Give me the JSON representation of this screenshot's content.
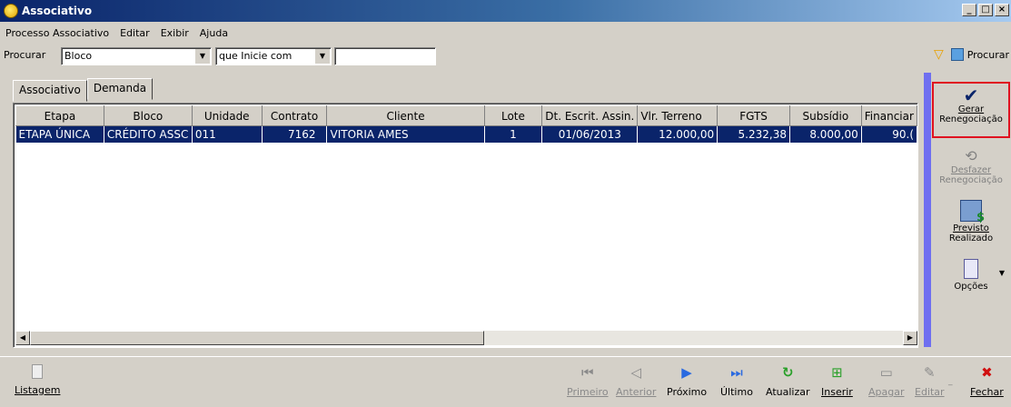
{
  "window": {
    "title": "Associativo"
  },
  "menu": [
    "Processo Associativo",
    "Editar",
    "Exibir",
    "Ajuda"
  ],
  "search": {
    "label": "Procurar",
    "field_value": "Bloco",
    "mode_value": "que Inicie com",
    "text_value": "",
    "button_label": "Procurar"
  },
  "tabs": [
    "Associativo",
    "Demanda"
  ],
  "grid": {
    "columns": [
      "Etapa",
      "Bloco",
      "Unidade",
      "Contrato",
      "Cliente",
      "Lote",
      "Dt. Escrit. Assin.",
      "Vlr. Terreno",
      "FGTS",
      "Subsídio",
      "Financiar"
    ],
    "rows": [
      [
        "ETAPA ÚNICA",
        "CRÉDITO ASSC",
        "011",
        "7162",
        "VITORIA AMES",
        "1",
        "01/06/2013",
        "12.000,00",
        "5.232,38",
        "8.000,00",
        "90.("
      ]
    ]
  },
  "sidebar": {
    "gerar_line1": "Gerar",
    "gerar_line2": "Renegociação",
    "desfazer_line1": "Desfazer",
    "desfazer_line2": "Renegociação",
    "previsto_line1": "Previsto",
    "previsto_line2": "Realizado",
    "opcoes": "Opções"
  },
  "bottom": {
    "listagem": "Listagem",
    "primeiro": "Primeiro",
    "anterior": "Anterior",
    "proximo": "Próximo",
    "ultimo": "Último",
    "atualizar": "Atualizar",
    "inserir": "Inserir",
    "apagar": "Apagar",
    "editar": "Editar",
    "fechar": "Fechar"
  },
  "colors": {
    "selection": "#0a246a",
    "highlight_border": "#e01020",
    "rail": "#6f6ff0"
  }
}
